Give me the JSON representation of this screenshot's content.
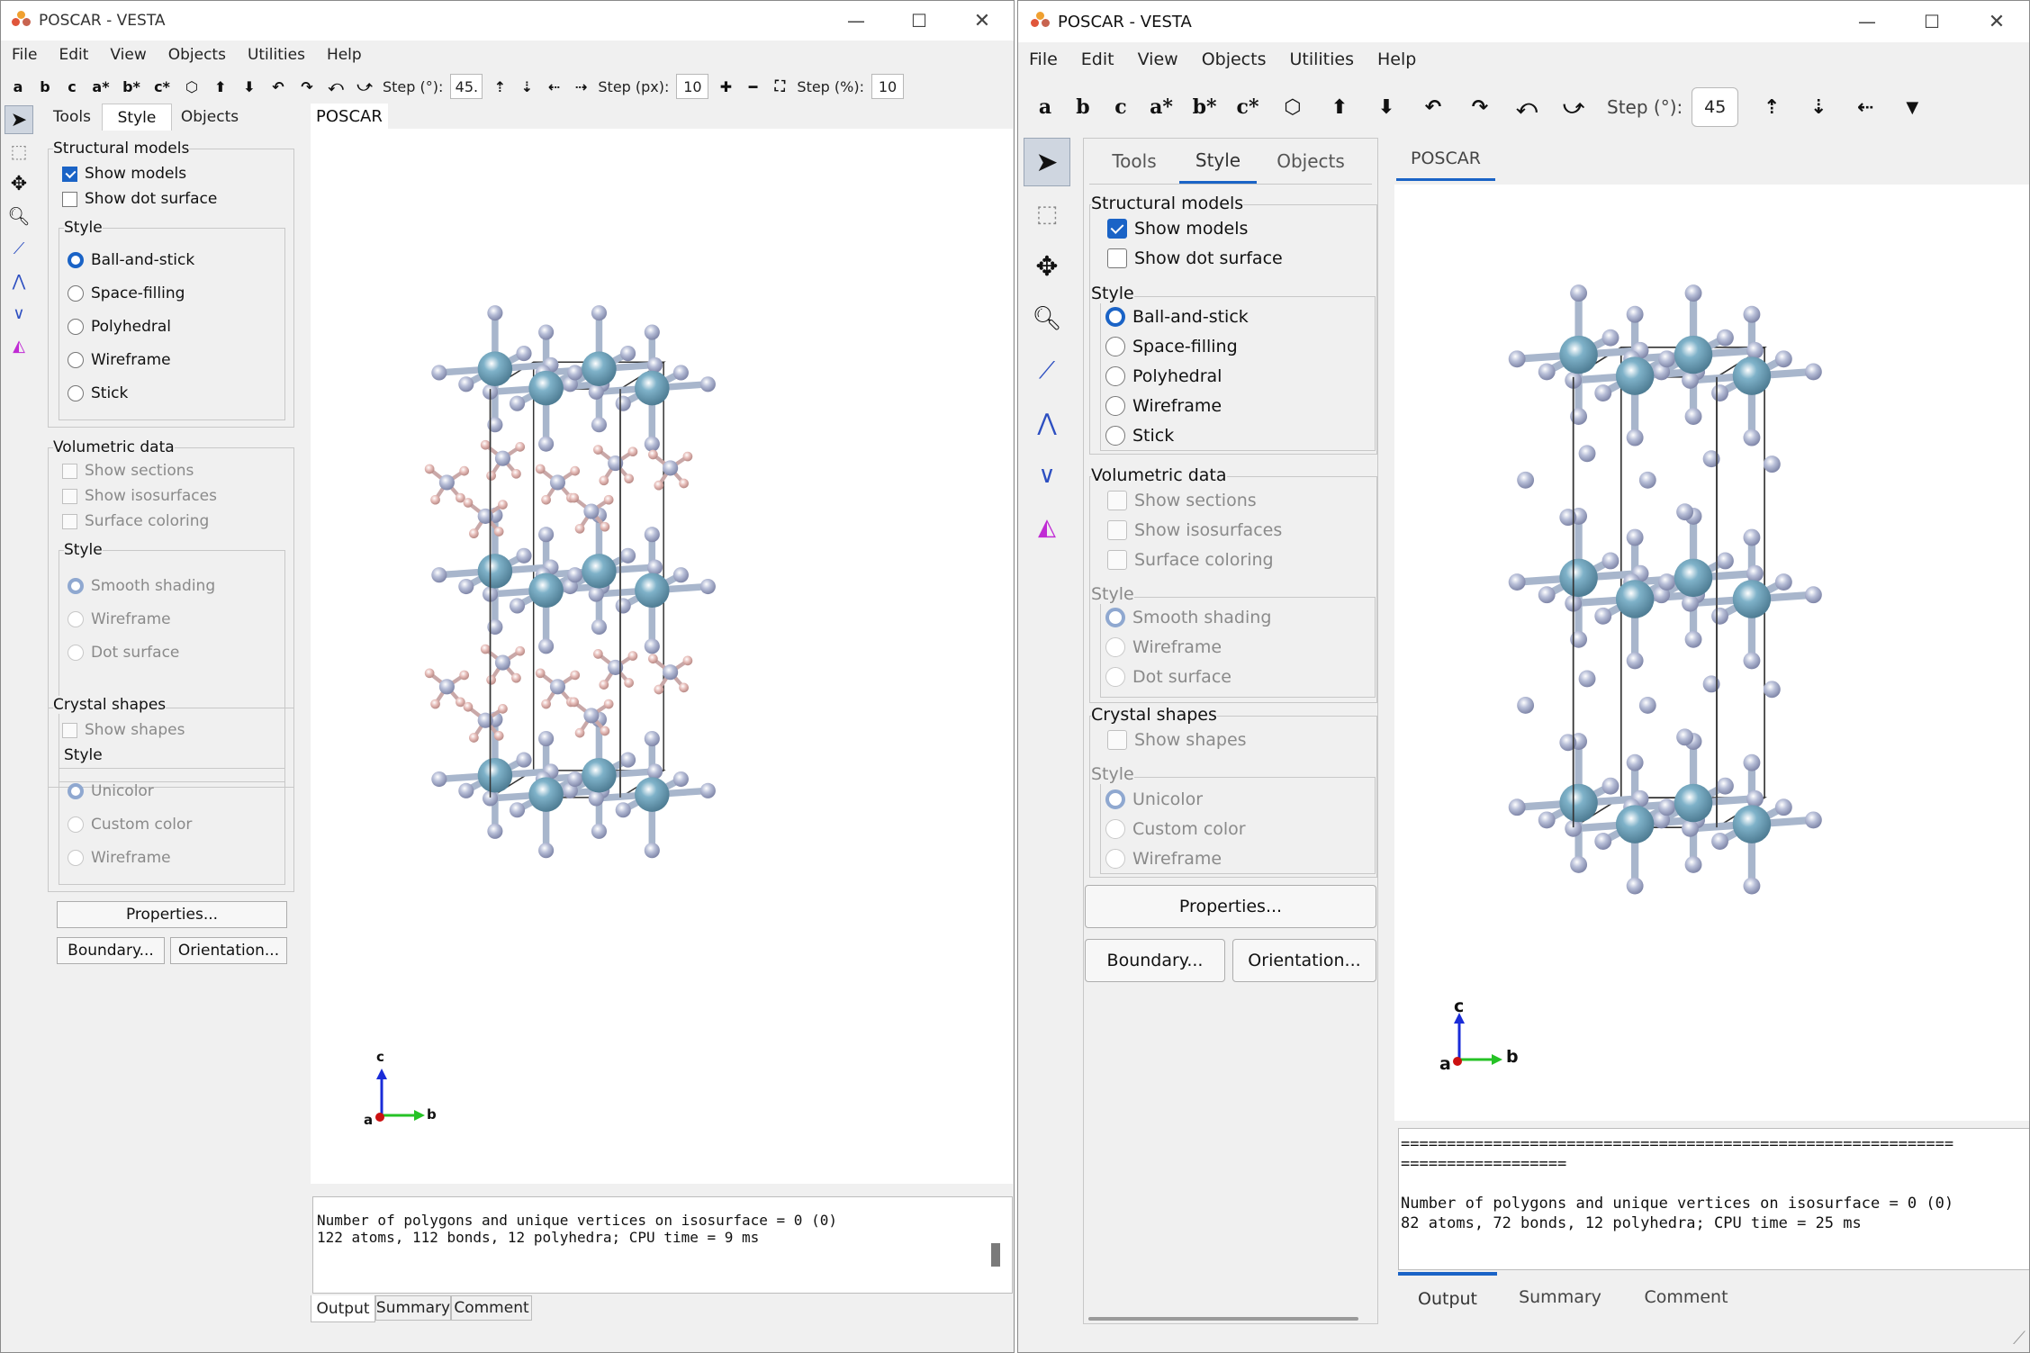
{
  "window1": {
    "title": "POSCAR - VESTA",
    "menu": [
      "File",
      "Edit",
      "View",
      "Objects",
      "Utilities",
      "Help"
    ],
    "toolbar": {
      "axis_buttons": [
        "a",
        "b",
        "c",
        "a*",
        "b*",
        "c*"
      ],
      "step_deg_label": "Step (°):",
      "step_deg_value": "45.",
      "step_px_label": "Step (px):",
      "step_px_value": "10",
      "step_pct_label": "Step (%):",
      "step_pct_value": "10"
    },
    "tabs": [
      "Tools",
      "Style",
      "Objects"
    ],
    "active_tab": "Style",
    "structural_models": {
      "title": "Structural models",
      "show_models": "Show models",
      "show_dot_surface": "Show dot surface",
      "style_title": "Style",
      "styles": [
        "Ball-and-stick",
        "Space-filling",
        "Polyhedral",
        "Wireframe",
        "Stick"
      ],
      "selected_style": "Ball-and-stick"
    },
    "volumetric": {
      "title": "Volumetric data",
      "show_sections": "Show sections",
      "show_isosurfaces": "Show isosurfaces",
      "surface_coloring": "Surface coloring",
      "style_title": "Style",
      "styles": [
        "Smooth shading",
        "Wireframe",
        "Dot surface"
      ]
    },
    "crystal": {
      "title": "Crystal shapes",
      "show_shapes": "Show shapes",
      "style_title": "Style",
      "styles": [
        "Unicolor",
        "Custom color",
        "Wireframe"
      ]
    },
    "buttons": {
      "properties": "Properties...",
      "boundary": "Boundary...",
      "orientation": "Orientation..."
    },
    "doc_tab": "POSCAR",
    "axes": {
      "c": "c",
      "a": "a",
      "b": "b"
    },
    "console": {
      "line1": "Number of polygons and unique vertices on isosurface = 0 (0)",
      "line2": "122 atoms, 112 bonds, 12 polyhedra; CPU time = 9 ms"
    },
    "bottom_tabs": [
      "Output",
      "Summary",
      "Comment"
    ]
  },
  "window2": {
    "title": "POSCAR - VESTA",
    "menu": [
      "File",
      "Edit",
      "View",
      "Objects",
      "Utilities",
      "Help"
    ],
    "toolbar": {
      "axis_buttons": [
        "a",
        "b",
        "c",
        "a*",
        "b*",
        "c*"
      ],
      "step_deg_label": "Step (°):",
      "step_deg_value": "45"
    },
    "tabs": [
      "Tools",
      "Style",
      "Objects"
    ],
    "active_tab": "Style",
    "structural_models": {
      "title": "Structural models",
      "show_models": "Show models",
      "show_dot_surface": "Show dot surface",
      "style_title": "Style",
      "styles": [
        "Ball-and-stick",
        "Space-filling",
        "Polyhedral",
        "Wireframe",
        "Stick"
      ],
      "selected_style": "Ball-and-stick"
    },
    "volumetric": {
      "title": "Volumetric data",
      "show_sections": "Show sections",
      "show_isosurfaces": "Show isosurfaces",
      "surface_coloring": "Surface coloring",
      "style_title": "Style",
      "styles": [
        "Smooth shading",
        "Wireframe",
        "Dot surface"
      ]
    },
    "crystal": {
      "title": "Crystal shapes",
      "show_shapes": "Show shapes",
      "style_title": "Style",
      "styles": [
        "Unicolor",
        "Custom color",
        "Wireframe"
      ]
    },
    "buttons": {
      "properties": "Properties...",
      "boundary": "Boundary...",
      "orientation": "Orientation..."
    },
    "doc_tab": "POSCAR",
    "axes": {
      "c": "c",
      "a": "a",
      "b": "b"
    },
    "console": {
      "separator1": "============================================================",
      "separator2": "==================",
      "line1": "Number of polygons and unique vertices on isosurface = 0 (0)",
      "line2": "82 atoms, 72 bonds, 12 polyhedra; CPU time = 25 ms"
    },
    "bottom_tabs": [
      "Output",
      "Summary",
      "Comment"
    ]
  },
  "colors": {
    "metal_atom": "#7fb2c9",
    "halide_atom": "#b8bfd8",
    "organic_atom": "#e6bcb8",
    "accent_blue": "#1a63c6",
    "axis_c": "#1a2cd8",
    "axis_b": "#25c225",
    "axis_a": "#cc1111"
  }
}
